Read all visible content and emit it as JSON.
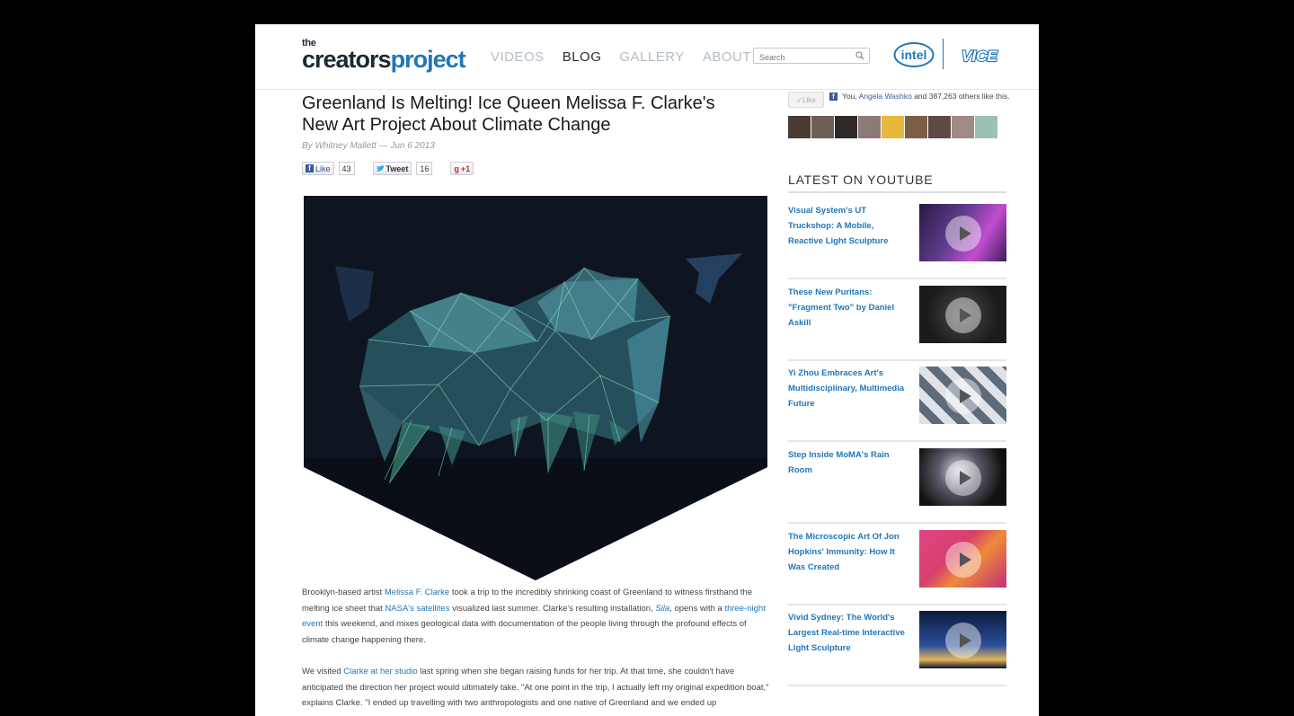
{
  "site": {
    "logo_small": "the",
    "logo_main": "creators",
    "logo_accent": "project",
    "nav": [
      "VIDEOS",
      "BLOG",
      "GALLERY",
      "ABOUT"
    ],
    "nav_active": "BLOG",
    "search_placeholder": "Search",
    "partner_intel": "intel",
    "partner_vice": "VICE"
  },
  "article": {
    "title": "Greenland Is Melting! Ice Queen Melissa F. Clarke's New Art Project About Climate Change",
    "byline": "By Whitney Mallett — Jun 6 2013",
    "share": {
      "like_label": "Like",
      "like_count": "43",
      "tweet_label": "Tweet",
      "tweet_count": "16",
      "plus_label": "+1"
    },
    "p1": {
      "t1": "Brooklyn-based artist ",
      "link1": "Melissa F. Clarke",
      "t2": " took a trip to the incredibly shrinking coast of Greenland to witness firsthand the melting ice sheet that ",
      "link2": "NASA's satellites",
      "t3": " visualized last summer. Clarke's resulting installation, ",
      "link3": "Sila",
      "t4": ", opens with a ",
      "link4": "three-night event",
      "t5": " this weekend, and mixes geological data with documentation of the people living through the profound effects of climate change happening there."
    },
    "p2": {
      "t1": "We visited ",
      "link1": "Clarke at her studio",
      "t2": " last spring when she began raising funds for her trip. At that time, she couldn't have anticipated the direction her project would ultimately take. \"At one point in the trip, I actually left my original expedition boat,\" explains Clarke. \"I ended up travelling with two anthropologists and one native of Greenland and we ended up"
    }
  },
  "facebook": {
    "like_label": "Like",
    "text_prefix": "You, ",
    "friend": "Angela Washko",
    "text_suffix": " and 387,263 others like this."
  },
  "sidebar": {
    "title": "LATEST ON YOUTUBE",
    "videos": [
      {
        "title": "Visual System's UT Truckshop: A Mobile, Reactive Light Sculpture"
      },
      {
        "title": "These New Puritans: \"Fragment Two\" by Daniel Askill"
      },
      {
        "title": "Yi Zhou Embraces Art's Multidisciplinary, Multimedia Future"
      },
      {
        "title": "Step Inside MoMA's Rain Room"
      },
      {
        "title": "The Microscopic Art Of Jon Hopkins' Immunity: How It Was Created"
      },
      {
        "title": "Vivid Sydney: The World's Largest Real-time Interactive Light Sculpture"
      }
    ]
  },
  "colors": {
    "brand_blue": "#1f76b8",
    "facebook_blue": "#3b5998",
    "background": "#000000"
  }
}
